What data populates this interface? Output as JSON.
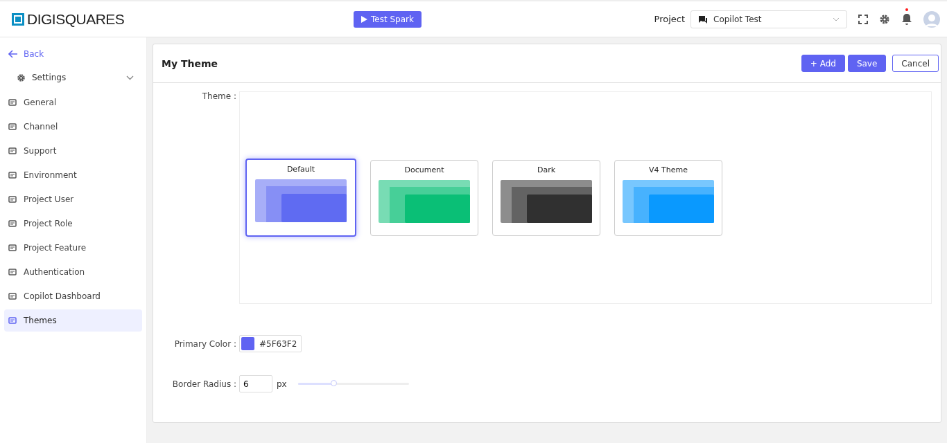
{
  "header": {
    "logo": "DIGISQUARES",
    "run_button": "Test Spark",
    "project_label": "Project",
    "project_value": "Copilot Test",
    "has_notification": true
  },
  "sidebar": {
    "back": "Back",
    "section": {
      "label": "Settings",
      "expanded": true
    },
    "items": [
      {
        "label": "General",
        "selected": false
      },
      {
        "label": "Channel",
        "selected": false
      },
      {
        "label": "Support",
        "selected": false
      },
      {
        "label": "Environment",
        "selected": false
      },
      {
        "label": "Project User",
        "selected": false
      },
      {
        "label": "Project Role",
        "selected": false
      },
      {
        "label": "Project Feature",
        "selected": false
      },
      {
        "label": "Authentication",
        "selected": false
      },
      {
        "label": "Copilot Dashboard",
        "selected": false
      },
      {
        "label": "Themes",
        "selected": true
      }
    ]
  },
  "card": {
    "title": "My Theme",
    "buttons": [
      "+ Add",
      "Save",
      "Cancel"
    ],
    "theme_label": "Theme :",
    "themes": [
      {
        "name": "Default",
        "color": "#5f6bf2",
        "selected": true
      },
      {
        "name": "Document",
        "color": "#0abf76",
        "selected": false
      },
      {
        "name": "Dark",
        "color": "#303030",
        "selected": false
      },
      {
        "name": "V4 Theme",
        "color": "#0a99fe",
        "selected": false
      }
    ],
    "primary_color": {
      "label": "Primary Color :",
      "value": "#5F63F2"
    },
    "border_radius": {
      "label": "Border Radius :",
      "value": "6",
      "unit": "px",
      "level": 0.33
    }
  }
}
